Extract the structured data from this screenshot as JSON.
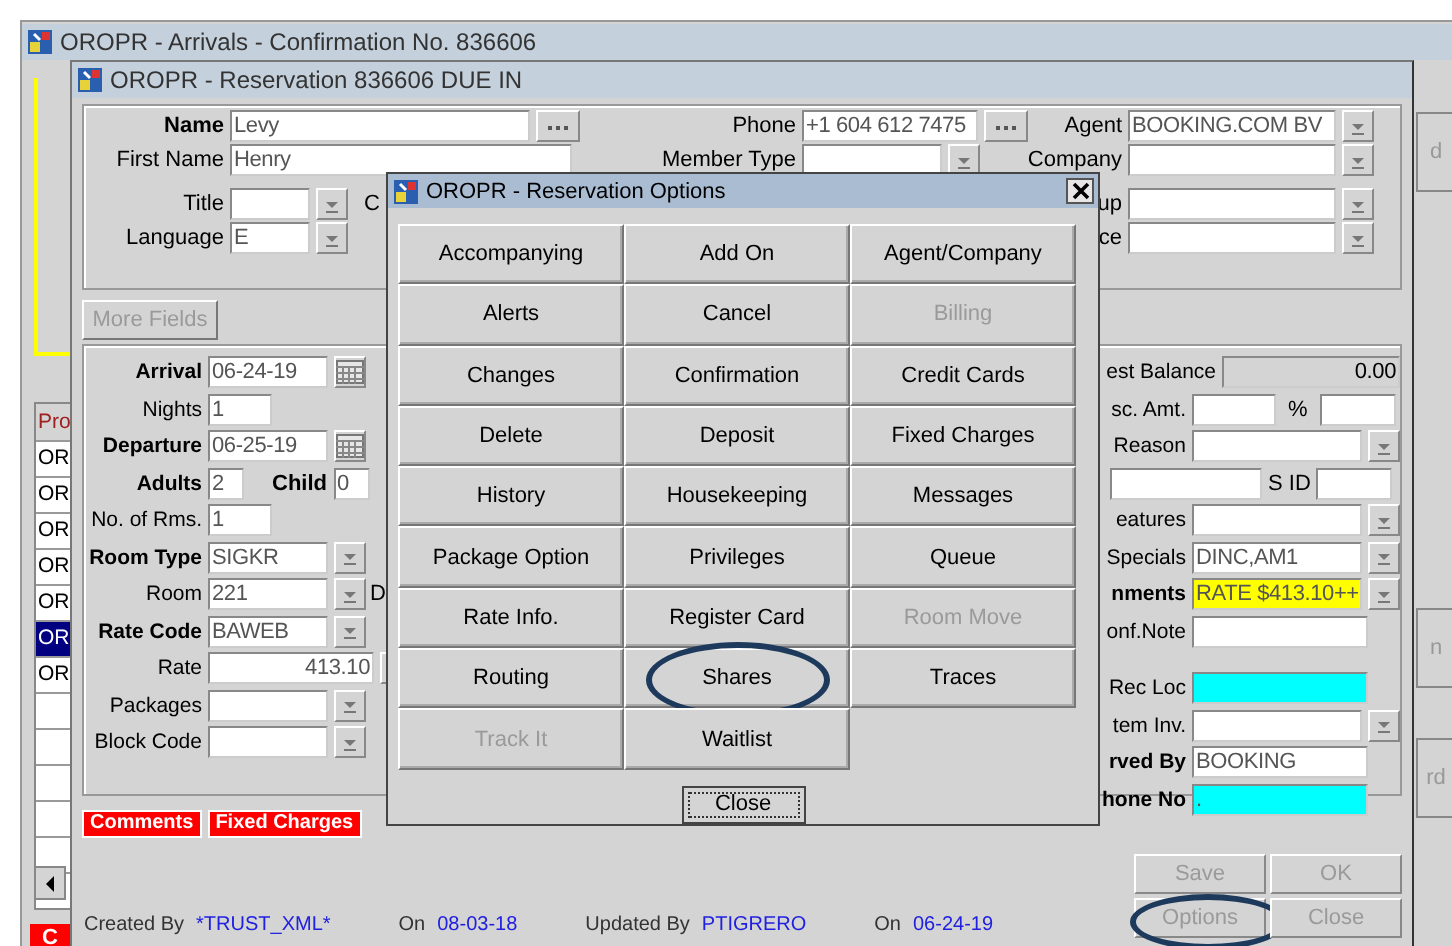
{
  "outer_window": {
    "title": "OROPR - Arrivals - Confirmation No.  836606"
  },
  "background_list": {
    "header": "Pro",
    "rows": [
      {
        "text": "OR",
        "selected": false
      },
      {
        "text": "OR",
        "selected": false
      },
      {
        "text": "OR",
        "selected": false
      },
      {
        "text": "OR",
        "selected": false
      },
      {
        "text": "OR",
        "selected": false
      },
      {
        "text": "OR",
        "selected": true
      },
      {
        "text": "OR",
        "selected": false
      }
    ]
  },
  "background_tab": "C",
  "edge_buttons": [
    "d",
    "n",
    "rd"
  ],
  "reservation_window": {
    "title": "OROPR - Reservation 836606  DUE IN",
    "guest_panel": [
      [
        {
          "label": "Name",
          "bold": true,
          "kind": "dots",
          "value": "Levy"
        },
        {
          "label": "First Name",
          "bold": false,
          "kind": "text",
          "value": "Henry"
        },
        {
          "label": "Title",
          "bold": false,
          "kind": "lookup",
          "after": "C"
        },
        {
          "label": "Language",
          "bold": false,
          "kind": "lookup",
          "value": "E"
        }
      ],
      [
        {
          "label": "Phone",
          "bold": false,
          "kind": "dots",
          "value": "+1 604 612 7475"
        },
        {
          "label": "Member Type",
          "bold": false,
          "kind": "lookup"
        }
      ],
      [
        {
          "label": "Agent",
          "bold": false,
          "kind": "lookup",
          "value": "BOOKING.COM BV"
        },
        {
          "label": "Company",
          "bold": false,
          "kind": "lookup"
        },
        {
          "label": "up",
          "bold": false,
          "kind": "lookup"
        },
        {
          "label": "ce",
          "bold": false,
          "kind": "lookup"
        }
      ]
    ],
    "more_fields": {
      "label": "More Fields",
      "disabled": true
    },
    "stay_left": [
      {
        "label": "Arrival",
        "bold": true,
        "kind": "date",
        "value": "06-24-19"
      },
      {
        "label": "Nights",
        "bold": false,
        "kind": "number",
        "value": "1"
      },
      {
        "label": "Departure",
        "bold": true,
        "kind": "date",
        "value": "06-25-19"
      },
      {
        "label": "Adults",
        "bold": true,
        "kind": "pair",
        "value": "2",
        "label2": "Child",
        "value2": "0"
      },
      {
        "label": "No. of Rms.",
        "bold": false,
        "kind": "number",
        "value": "1"
      },
      {
        "label": "Room Type",
        "bold": true,
        "kind": "lookup",
        "value": "SIGKR"
      },
      {
        "label": "Room",
        "bold": false,
        "kind": "lookup",
        "value": "221",
        "after": "D"
      },
      {
        "label": "Rate Code",
        "bold": true,
        "kind": "lookup",
        "value": "BAWEB"
      },
      {
        "label": "Rate",
        "bold": false,
        "kind": "amount",
        "value": "413.10"
      },
      {
        "label": "Packages",
        "bold": false,
        "kind": "lookup"
      },
      {
        "label": "Block Code",
        "bold": false,
        "kind": "lookup"
      }
    ],
    "stay_right": [
      {
        "label": "est Balance",
        "bold": false,
        "kind": "display",
        "value": "0.00"
      },
      {
        "label": "sc. Amt.",
        "bold": false,
        "kind": "percent",
        "label2": "%"
      },
      {
        "label": "Reason",
        "bold": false,
        "kind": "lookup"
      },
      {
        "kind": "sid",
        "label2": "S ID"
      },
      {
        "label": "eatures",
        "bold": false,
        "kind": "lookup"
      },
      {
        "label": "Specials",
        "bold": false,
        "kind": "lookup",
        "value": "DINC,AM1"
      },
      {
        "label": "nments",
        "bold": true,
        "kind": "lookup",
        "value": "RATE $413.10++",
        "color": "#ffff00"
      },
      {
        "label": "onf.Note",
        "bold": false,
        "kind": "text"
      },
      {
        "label": "Rec Loc",
        "bold": false,
        "kind": "text",
        "color": "#00ffff"
      },
      {
        "label": "tem Inv.",
        "bold": false,
        "kind": "lookup"
      },
      {
        "label": "rved By",
        "bold": true,
        "kind": "text",
        "value": "BOOKING"
      },
      {
        "label": "hone No",
        "bold": true,
        "kind": "text",
        "value": ".",
        "color": "#00ffff"
      }
    ],
    "tabs": [
      {
        "label": "Comments"
      },
      {
        "label": "Fixed Charges"
      }
    ],
    "footer": [
      {
        "label": "Created By",
        "value": "*TRUST_XML*"
      },
      {
        "label": "On",
        "value": "08-03-18"
      },
      {
        "label": "Updated By",
        "value": "PTIGRERO"
      },
      {
        "label": "On",
        "value": "06-24-19"
      }
    ],
    "buttons": [
      {
        "label": "Save",
        "disabled": true,
        "circled": false
      },
      {
        "label": "OK",
        "disabled": true,
        "circled": false
      },
      {
        "label": "Options",
        "disabled": true,
        "circled": true
      },
      {
        "label": "Close",
        "disabled": true,
        "circled": false
      }
    ]
  },
  "options_dialog": {
    "title": "OROPR - Reservation Options",
    "options": [
      {
        "label": "Accompanying",
        "disabled": false,
        "circled": false
      },
      {
        "label": "Add On",
        "disabled": false,
        "circled": false
      },
      {
        "label": "Agent/Company",
        "disabled": false,
        "circled": false
      },
      {
        "label": "Alerts",
        "disabled": false,
        "circled": false
      },
      {
        "label": "Cancel",
        "disabled": false,
        "circled": false
      },
      {
        "label": "Billing",
        "disabled": true,
        "circled": false
      },
      {
        "label": "Changes",
        "disabled": false,
        "circled": false
      },
      {
        "label": "Confirmation",
        "disabled": false,
        "circled": false
      },
      {
        "label": "Credit Cards",
        "disabled": false,
        "circled": false
      },
      {
        "label": "Delete",
        "disabled": false,
        "circled": false
      },
      {
        "label": "Deposit",
        "disabled": false,
        "circled": false
      },
      {
        "label": "Fixed Charges",
        "disabled": false,
        "circled": false
      },
      {
        "label": "History",
        "disabled": false,
        "circled": false
      },
      {
        "label": "Housekeeping",
        "disabled": false,
        "circled": false
      },
      {
        "label": "Messages",
        "disabled": false,
        "circled": false
      },
      {
        "label": "Package Option",
        "disabled": false,
        "circled": false
      },
      {
        "label": "Privileges",
        "disabled": false,
        "circled": false
      },
      {
        "label": "Queue",
        "disabled": false,
        "circled": false
      },
      {
        "label": "Rate Info.",
        "disabled": false,
        "circled": false
      },
      {
        "label": "Register Card",
        "disabled": false,
        "circled": false
      },
      {
        "label": "Room Move",
        "disabled": true,
        "circled": false
      },
      {
        "label": "Routing",
        "disabled": false,
        "circled": false
      },
      {
        "label": "Shares",
        "disabled": false,
        "circled": true
      },
      {
        "label": "Traces",
        "disabled": false,
        "circled": false
      },
      {
        "label": "Track It",
        "disabled": true,
        "circled": false
      },
      {
        "label": "Waitlist",
        "disabled": false,
        "circled": false
      }
    ],
    "close": "Close"
  }
}
